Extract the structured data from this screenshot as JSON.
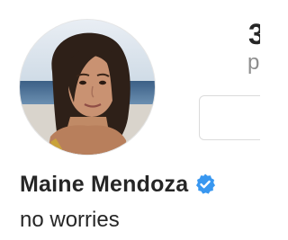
{
  "profile": {
    "name": "Maine Mendoza",
    "bio": "no worries",
    "verified": true,
    "verified_icon": "verified-badge-icon",
    "avatar_icon": "profile-photo"
  },
  "stats": {
    "count_partial": "3",
    "label_partial": "p"
  },
  "colors": {
    "verified_blue": "#3897f0",
    "text": "#262626",
    "muted": "#8e8e8e",
    "border": "#dbdbdb"
  }
}
